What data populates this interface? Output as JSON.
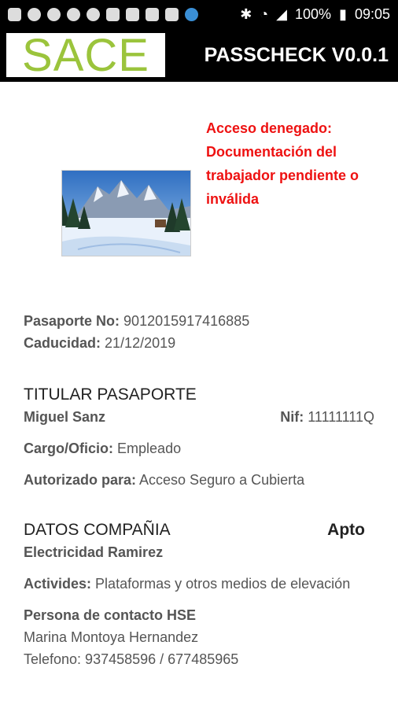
{
  "status_bar": {
    "battery": "100%",
    "time": "09:05"
  },
  "header": {
    "logo_text": "SACE",
    "title": "PASSCHECK V0.0.1"
  },
  "access": {
    "message": "Acceso denegado: Documentación del trabajador pendiente o inválida"
  },
  "passport": {
    "number_label": "Pasaporte No:",
    "number_value": "9012015917416885",
    "expiry_label": "Caducidad:",
    "expiry_value": "21/12/2019"
  },
  "holder": {
    "heading": "TITULAR PASAPORTE",
    "name": "Miguel Sanz",
    "nif_label": "Nif:",
    "nif_value": "11111111Q",
    "role_label": "Cargo/Oficio:",
    "role_value": "Empleado",
    "authorized_label": "Autorizado para:",
    "authorized_value": "Acceso Seguro a Cubierta"
  },
  "company": {
    "heading": "DATOS COMPAÑIA",
    "status": "Apto",
    "name": "Electricidad Ramirez",
    "activities_label": "Activides:",
    "activities_value": "Plataformas y otros medios de elevación",
    "contact_label": "Persona de contacto HSE",
    "contact_name": "Marina Montoya Hernandez",
    "phone": "Telefono: 937458596 / 677485965"
  }
}
